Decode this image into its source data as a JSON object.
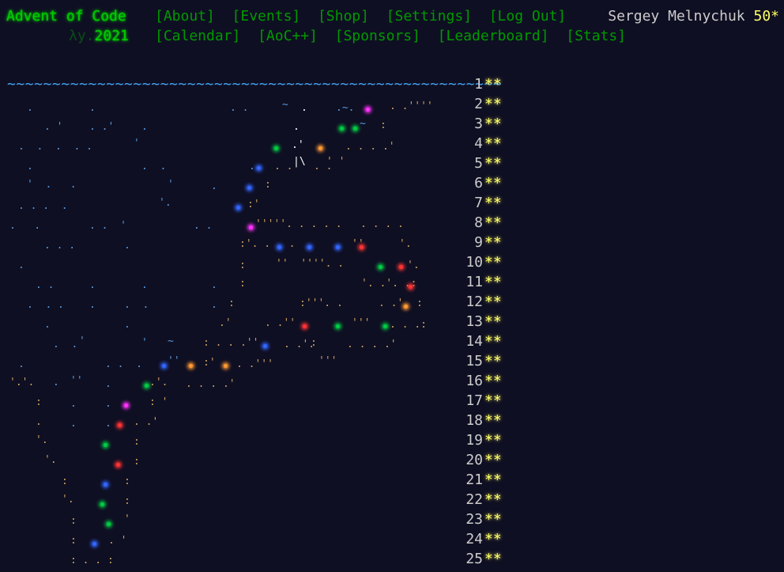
{
  "header": {
    "title": "Advent of Code",
    "year_prefix": "λy.",
    "year": "2021",
    "nav_row1": [
      "[About]",
      "[Events]",
      "[Shop]",
      "[Settings]",
      "[Log Out]"
    ],
    "nav_row2": [
      "[Calendar]",
      "[AoC++]",
      "[Sponsors]",
      "[Leaderboard]",
      "[Stats]"
    ],
    "user_name": "Sergey Melnychuk",
    "star_count": "50*"
  },
  "calendar": {
    "wave": "~~~~~~~~~~~~~~~~~~~~~~~~~~~~~~~~~~~~~~~~~~~~~~~~~~~~~~~",
    "days": [
      {
        "day": "1",
        "stars": "**"
      },
      {
        "day": "2",
        "stars": "**"
      },
      {
        "day": "3",
        "stars": "**"
      },
      {
        "day": "4",
        "stars": "**"
      },
      {
        "day": "5",
        "stars": "**"
      },
      {
        "day": "6",
        "stars": "**"
      },
      {
        "day": "7",
        "stars": "**"
      },
      {
        "day": "8",
        "stars": "**"
      },
      {
        "day": "9",
        "stars": "**"
      },
      {
        "day": "10",
        "stars": "**"
      },
      {
        "day": "11",
        "stars": "**"
      },
      {
        "day": "12",
        "stars": "**"
      },
      {
        "day": "13",
        "stars": "**"
      },
      {
        "day": "14",
        "stars": "**"
      },
      {
        "day": "15",
        "stars": "**"
      },
      {
        "day": "16",
        "stars": "**"
      },
      {
        "day": "17",
        "stars": "**"
      },
      {
        "day": "18",
        "stars": "**"
      },
      {
        "day": "19",
        "stars": "**"
      },
      {
        "day": "20",
        "stars": "**"
      },
      {
        "day": "21",
        "stars": "**"
      },
      {
        "day": "22",
        "stars": "**"
      },
      {
        "day": "23",
        "stars": "**"
      },
      {
        "day": "24",
        "stars": "**"
      },
      {
        "day": "25",
        "stars": "**"
      }
    ]
  }
}
